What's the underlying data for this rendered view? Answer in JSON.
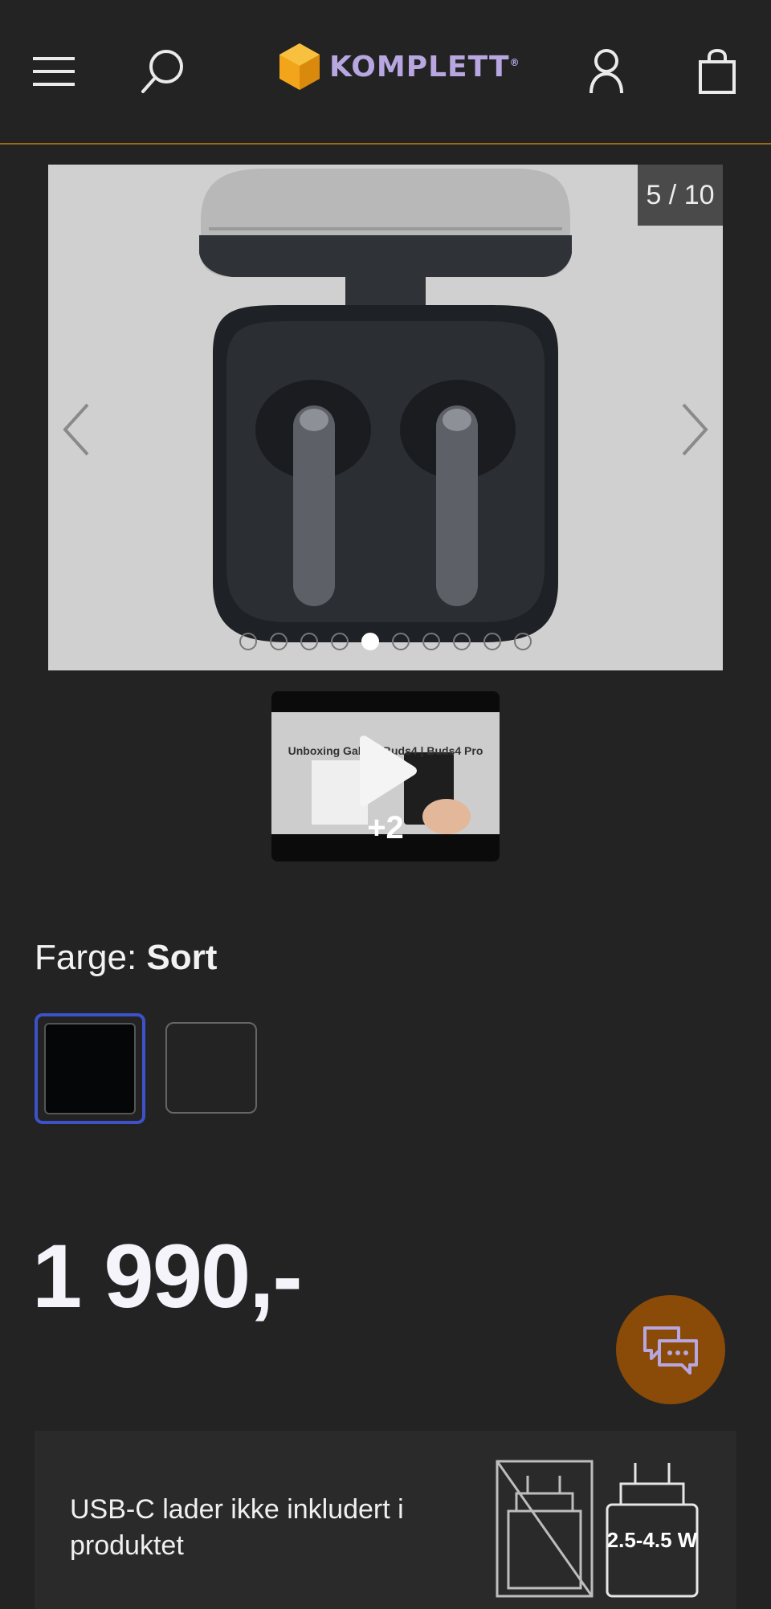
{
  "header": {
    "logo_text": "KOMPLETT",
    "logo_mark": "®",
    "accent_color": "#9a6a1a",
    "logo_color": "#b7a6e0",
    "icons": [
      "menu-icon",
      "search-icon",
      "user-icon",
      "cart-icon"
    ]
  },
  "gallery": {
    "counter": "5 / 10",
    "total_images": 10,
    "active_index": 5,
    "prev_icon": "chevron-left-icon",
    "next_icon": "chevron-right-icon"
  },
  "video": {
    "caption": "Unboxing Galaxy Buds4 | Buds4 Pro",
    "extra_count": "+2",
    "icon": "play-icon"
  },
  "color": {
    "label": "Farge:",
    "value": "Sort",
    "options": [
      {
        "name": "Sort",
        "hex": "#040608",
        "selected": true
      },
      {
        "name": "",
        "hex": "#232323",
        "selected": false
      }
    ],
    "selected_border": "#3d52c8"
  },
  "price": {
    "amount": "1 990,-"
  },
  "chat": {
    "icon": "chat-icon",
    "color": "#8a4a08"
  },
  "charger": {
    "text": "USB-C lader ikke inkludert i produktet",
    "watt": "2.5-4.5 W"
  }
}
